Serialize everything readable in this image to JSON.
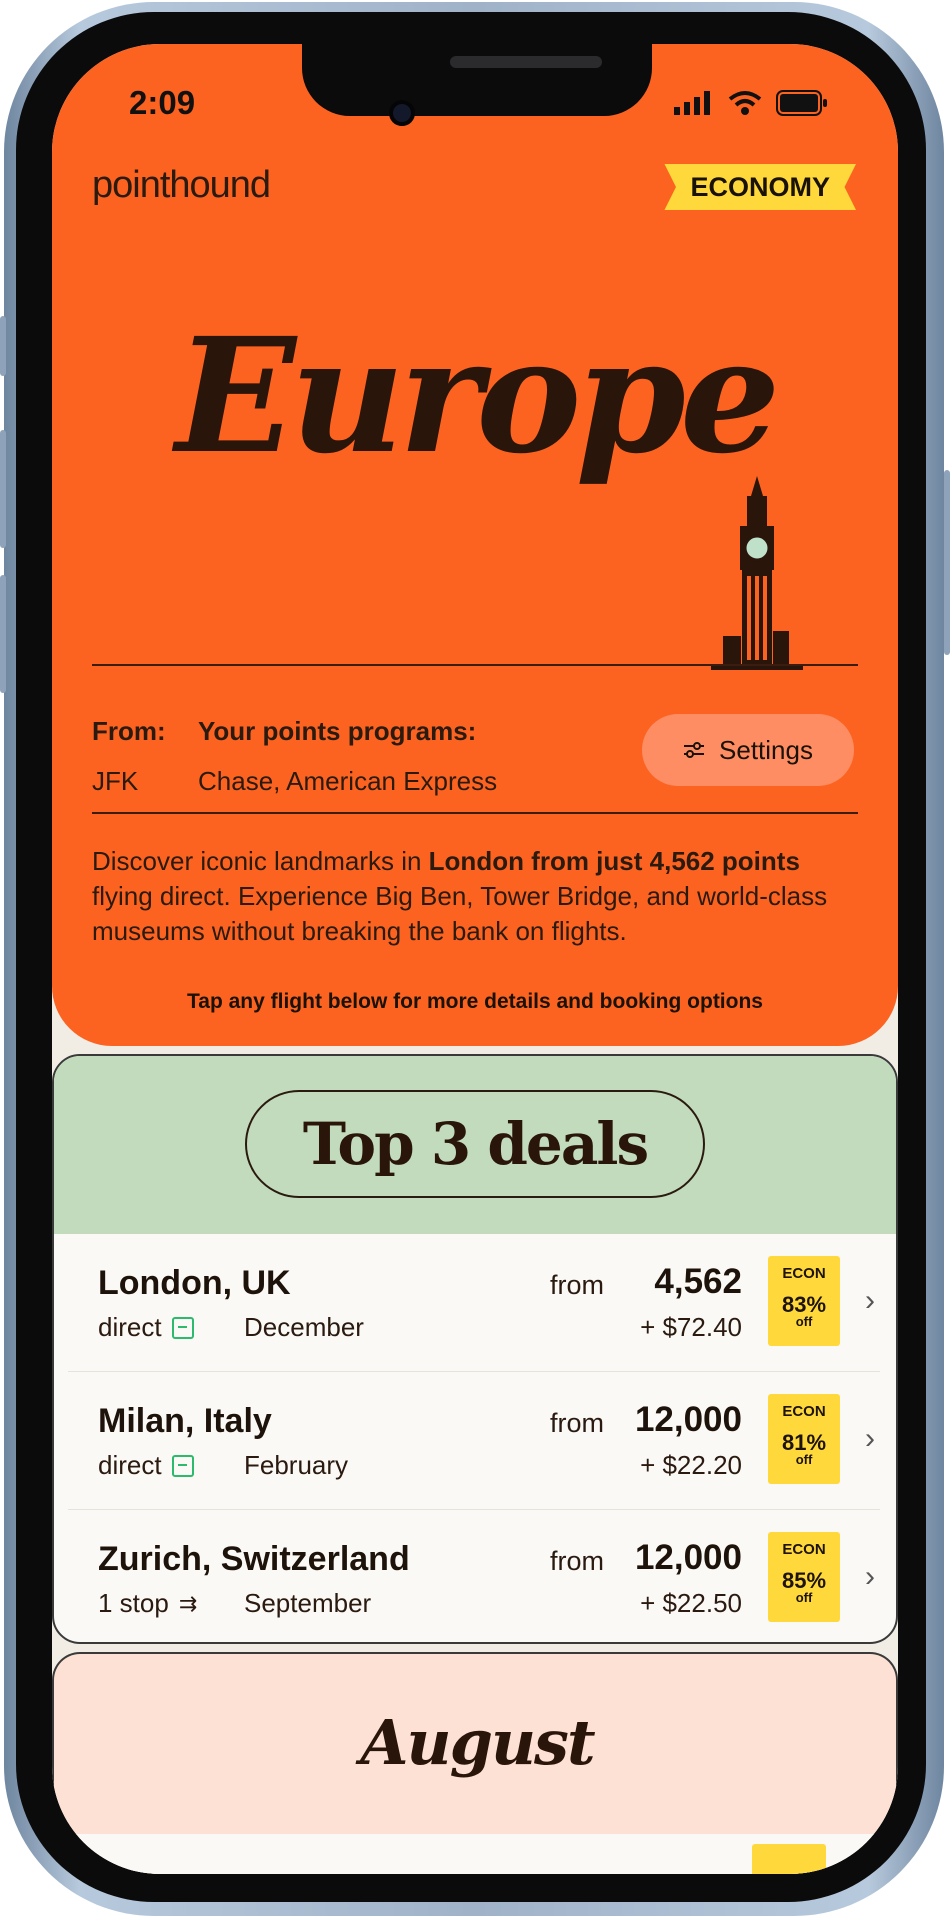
{
  "status": {
    "time": "2:09"
  },
  "brand": "pointhound",
  "tier": "ECONOMY",
  "hero_title": "Europe",
  "origin": {
    "label": "From:",
    "value": "JFK"
  },
  "programs": {
    "label": "Your points programs:",
    "value": "Chase, American Express"
  },
  "settings_label": "Settings",
  "description": {
    "part1": "Discover iconic landmarks in ",
    "bold": "London from just 4,562 points",
    "part2": " flying direct. Experience Big Ben, Tower Bridge, and world-class museums without breaking the bank on flights."
  },
  "tap_hint": "Tap any flight below for more details and booking options",
  "deals_title": "Top 3 deals",
  "deals": [
    {
      "city": "London, UK",
      "stops": "direct",
      "month": "December",
      "from": "from",
      "points": "4,562",
      "fee": "+ $72.40",
      "cabin": "ECON",
      "discount": "83%",
      "off": "off"
    },
    {
      "city": "Milan, Italy",
      "stops": "direct",
      "month": "February",
      "from": "from",
      "points": "12,000",
      "fee": "+ $22.20",
      "cabin": "ECON",
      "discount": "81%",
      "off": "off"
    },
    {
      "city": "Zurich, Switzerland",
      "stops": "1 stop",
      "month": "September",
      "from": "from",
      "points": "12,000",
      "fee": "+ $22.50",
      "cabin": "ECON",
      "discount": "85%",
      "off": "off"
    }
  ],
  "section_title": "August",
  "colors": {
    "hero": "#fd6320",
    "badge": "#ffd93b",
    "deals_header": "#c2dbbc",
    "section": "#fde1d5",
    "direct_icon": "#2cba6d"
  }
}
